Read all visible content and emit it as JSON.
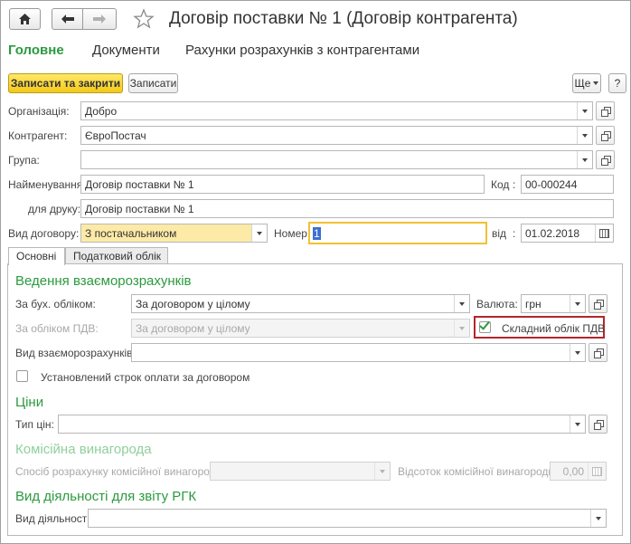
{
  "window": {
    "title": "Договір поставки № 1 (Договір контрагента)"
  },
  "nav": {
    "home_icon": "home-icon",
    "back_icon": "arrow-left-icon",
    "forward_icon": "arrow-right-icon",
    "favorite_icon": "star-icon"
  },
  "tabs": [
    "Головне",
    "Документи",
    "Рахунки розрахунків з контрагентами"
  ],
  "toolbar": {
    "save_close": "Записати та закрити",
    "save": "Записати",
    "more": "Ще",
    "help": "?"
  },
  "form": {
    "organization": {
      "label": "Організація:",
      "value": "Добро"
    },
    "counterparty": {
      "label": "Контрагент:",
      "value": "ЄвроПостач"
    },
    "group": {
      "label": "Група:",
      "value": ""
    },
    "name": {
      "label": "Найменування:",
      "value": "Договір поставки № 1"
    },
    "code": {
      "label": "Код",
      "colon": ":",
      "value": "00-000244"
    },
    "print_name": {
      "label": "для друку:",
      "value": "Договір поставки № 1"
    },
    "contract_type": {
      "label": "Вид договору:",
      "value": "З постачальником"
    },
    "number": {
      "label": "Номер:",
      "value": "1"
    },
    "date": {
      "label": "від",
      "colon": ":",
      "value": "01.02.2018"
    }
  },
  "panel_tabs": [
    "Основні",
    "Податковий облік"
  ],
  "main": {
    "settlements_section": "Ведення взаєморозрахунків",
    "accounting": {
      "label": "За бух. обліком:",
      "value": "За договором у цілому"
    },
    "currency": {
      "label": "Валюта:",
      "value": "грн"
    },
    "vat_accounting": {
      "label": "За обліком ПДВ:",
      "value": "За договором у цілому"
    },
    "complex_vat": {
      "label": "Складний облік ПДВ",
      "checked": true
    },
    "settlement_type": {
      "label": "Вид взаєморозрахунків:",
      "value": ""
    },
    "payment_term": {
      "label": "Установлений строк оплати за договором",
      "checked": false
    },
    "prices_section": "Ціни",
    "price_type": {
      "label": "Тип цін:",
      "value": ""
    },
    "commission_section": "Комісійна винагорода",
    "commission_method": {
      "label": "Спосіб розрахунку комісійної винагороди:",
      "value": ""
    },
    "commission_percent": {
      "label": "Відсоток комісійної винагороди:",
      "value": "0,00"
    },
    "rgk_section": "Вид діяльності для звіту РГК",
    "activity_type": {
      "label": "Вид діяльності:",
      "value": ""
    }
  },
  "colors": {
    "accent_green": "#2b9a3f",
    "primary_button": "#f3c818",
    "highlight_box": "#b3262b",
    "required_field": "#fdeaa7"
  }
}
